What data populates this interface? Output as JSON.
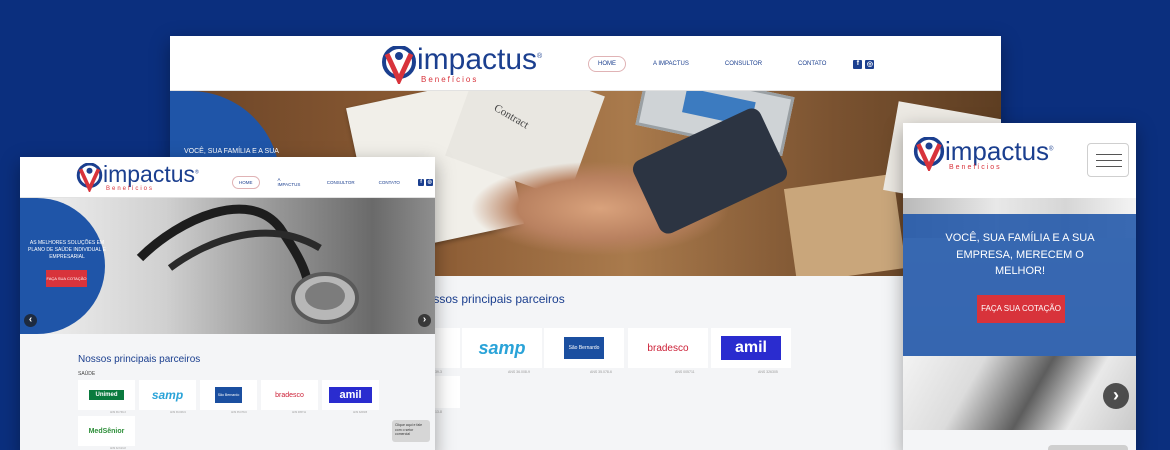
{
  "brand": {
    "name": "impactus",
    "tagline": "Benefícios",
    "registered": "®",
    "colors": {
      "background": "#0b2f7e",
      "primary": "#1b3f8f",
      "accent": "#d8333b"
    }
  },
  "desktop": {
    "nav": [
      "HOME",
      "A IMPACTUS",
      "CONSULTOR",
      "CONTATO"
    ],
    "social": {
      "facebook": "f",
      "instagram": "◎"
    },
    "hero_text": "VOCÊ, SUA FAMÍLIA E A SUA",
    "hero_image_text": "Contract",
    "partners_title": "Nossos principais parceiros",
    "partners": [
      {
        "name": "samp",
        "sub": "primeiro você",
        "reg": "ANS 36.008-9",
        "color": "#2aa3d8"
      },
      {
        "name": "São Bernardo",
        "sub": "saúde",
        "reg": "ANS 35.078-6",
        "color": "#1b4fa0"
      },
      {
        "name": "bradesco",
        "sub": "saúde",
        "reg": "ANS 005711",
        "color": "#cc1f36"
      },
      {
        "name": "amil",
        "sub": "",
        "reg": "ANS 326305",
        "color": "#2a2ccf"
      }
    ],
    "left_reg_1": "ANS 36.739-3",
    "left_reg_2": "ANS 32.613-8"
  },
  "tablet": {
    "nav": [
      "HOME",
      "A IMPACTUS",
      "CONSULTOR",
      "CONTATO"
    ],
    "social": {
      "facebook": "f",
      "instagram": "◎"
    },
    "hero_text": "AS MELHORES SOLUÇÕES EM PLANO DE SAÚDE INDIVIDUAL E EMPRESARIAL",
    "cta": "FAÇA SUA COTAÇÃO",
    "partners_title": "Nossos principais parceiros",
    "section_label": "SAÚDE",
    "partners": [
      {
        "name": "Unimed",
        "sub": "",
        "reg": "ANS 36.739-3",
        "color": "#0a7a3e"
      },
      {
        "name": "samp",
        "sub": "primeiro você",
        "reg": "ANS 36.008-9",
        "color": "#2aa3d8"
      },
      {
        "name": "São Bernardo",
        "sub": "saúde",
        "reg": "ANS 35.078-6",
        "color": "#1b4fa0"
      },
      {
        "name": "bradesco",
        "sub": "saúde",
        "reg": "ANS 005711",
        "color": "#cc1f36"
      },
      {
        "name": "amil",
        "sub": "",
        "reg": "ANS 326305",
        "color": "#2a2ccf"
      },
      {
        "name": "MedSênior",
        "sub": "",
        "reg": "ANS 32.613-8",
        "color": "#2e8f3a"
      }
    ],
    "chat_text": "Clique aqui e fale com o setor comercial",
    "arrow_left": "‹",
    "arrow_right": "›"
  },
  "mobile": {
    "hero_text": "VOCÊ, SUA FAMÍLIA E A SUA EMPRESA, MERECEM O MELHOR!",
    "cta": "FAÇA SUA COTAÇÃO",
    "arrow_left": "‹",
    "arrow_right": "›"
  }
}
